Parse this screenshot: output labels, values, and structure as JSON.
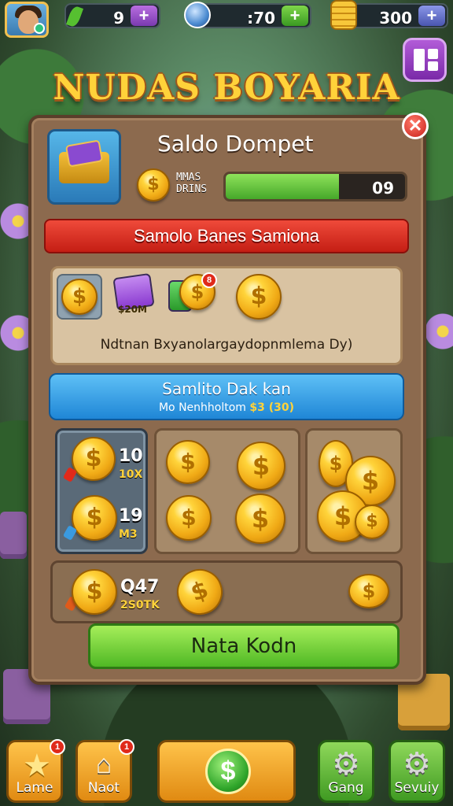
{
  "hud": {
    "energy_value": "9",
    "gems_value": ":70",
    "coins_value": "300",
    "plus_label": "+",
    "energy_icon": "leaf-icon",
    "gems_icon": "gem-icon",
    "coins_icon": "coin-stack-icon",
    "menu_icon": "grid-menu-icon"
  },
  "game_title": "NUDAS BOYARIA",
  "panel": {
    "title": "Saldo Dompet",
    "close_label": "✕",
    "balance_label_line1": "MMAS",
    "balance_label_line2": "DRINS",
    "balance_progress": 0.63,
    "balance_value": "09"
  },
  "red_banner": "Samolo Banes Samiona",
  "rewards": {
    "ticket_label": "$20M",
    "notif_count": "8",
    "description": "Ndtnan Bxyanolargaydopnmlema Dy)"
  },
  "blue_banner": {
    "line1": "Samlito Dak kan",
    "line2": "Mo Nenhholtom",
    "line2_value": "$3 (30)"
  },
  "packs": [
    {
      "amount": "10",
      "sub": "10X"
    },
    {
      "amount": "19",
      "sub": "M3"
    }
  ],
  "bottom_pack": {
    "amount": "Q47",
    "sub": "2S0TK"
  },
  "collect_button": "Nata Kodn",
  "nav": [
    {
      "label": "Lame",
      "badge": "1"
    },
    {
      "label": "Naot",
      "badge": "1"
    },
    {
      "label": "$"
    },
    {
      "label": "Gang"
    },
    {
      "label": "Sevuiy"
    }
  ],
  "colors": {
    "accent_gold": "#ffd23a",
    "panel_brown": "#8c6a4e",
    "banner_red": "#c41e14",
    "banner_blue": "#1f86d6",
    "button_green": "#4fb824"
  }
}
